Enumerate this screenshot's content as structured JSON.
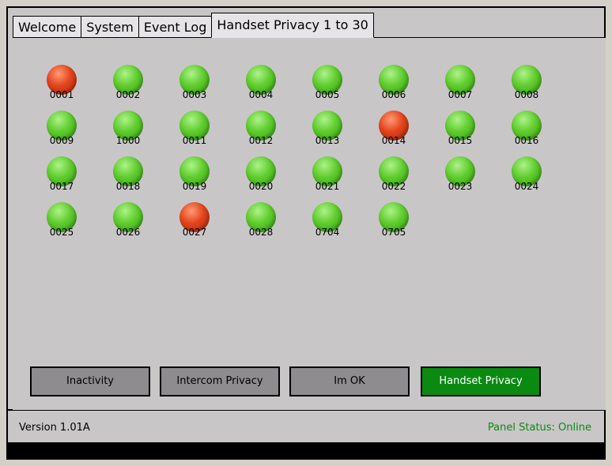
{
  "tabs": [
    {
      "label": "Welcome",
      "active": false
    },
    {
      "label": "System",
      "active": false
    },
    {
      "label": "Event Log",
      "active": false
    },
    {
      "label": "Handset Privacy 1 to 30",
      "active": true
    }
  ],
  "handsets": [
    {
      "id": "0001",
      "status": "red"
    },
    {
      "id": "0002",
      "status": "green"
    },
    {
      "id": "0003",
      "status": "green"
    },
    {
      "id": "0004",
      "status": "green"
    },
    {
      "id": "0005",
      "status": "green"
    },
    {
      "id": "0006",
      "status": "green"
    },
    {
      "id": "0007",
      "status": "green"
    },
    {
      "id": "0008",
      "status": "green"
    },
    {
      "id": "0009",
      "status": "green"
    },
    {
      "id": "1000",
      "status": "green"
    },
    {
      "id": "0011",
      "status": "green"
    },
    {
      "id": "0012",
      "status": "green"
    },
    {
      "id": "0013",
      "status": "green"
    },
    {
      "id": "0014",
      "status": "red"
    },
    {
      "id": "0015",
      "status": "green"
    },
    {
      "id": "0016",
      "status": "green"
    },
    {
      "id": "0017",
      "status": "green"
    },
    {
      "id": "0018",
      "status": "green"
    },
    {
      "id": "0019",
      "status": "green"
    },
    {
      "id": "0020",
      "status": "green"
    },
    {
      "id": "0021",
      "status": "green"
    },
    {
      "id": "0022",
      "status": "green"
    },
    {
      "id": "0023",
      "status": "green"
    },
    {
      "id": "0024",
      "status": "green"
    },
    {
      "id": "0025",
      "status": "green"
    },
    {
      "id": "0026",
      "status": "green"
    },
    {
      "id": "0027",
      "status": "red"
    },
    {
      "id": "0028",
      "status": "green"
    },
    {
      "id": "0704",
      "status": "green"
    },
    {
      "id": "0705",
      "status": "green"
    }
  ],
  "buttons": {
    "inactivity": "Inactivity",
    "intercom_privacy": "Intercom Privacy",
    "im_ok": "Im OK",
    "handset_privacy": "Handset Privacy"
  },
  "status": {
    "version": "Version 1.01A",
    "panel": "Panel Status: Online"
  },
  "colors": {
    "green": "#5ecc2c",
    "red": "#e2431b",
    "active_button": "#0b8a12"
  }
}
